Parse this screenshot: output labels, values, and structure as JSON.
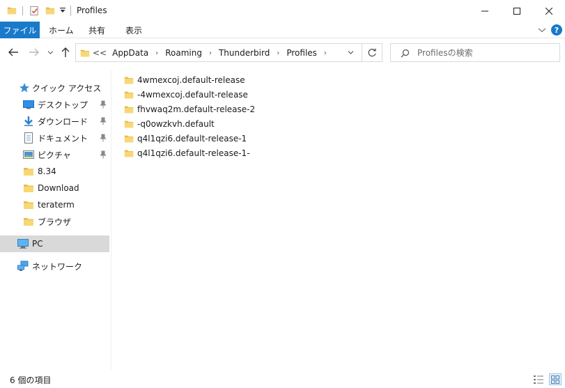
{
  "window": {
    "title": "Profiles"
  },
  "ribbon": {
    "tabs": [
      {
        "label": "ファイル"
      },
      {
        "label": "ホーム"
      },
      {
        "label": "共有"
      },
      {
        "label": "表示"
      }
    ],
    "help_label": "?"
  },
  "address": {
    "overflow": "<<",
    "crumbs": [
      "AppData",
      "Roaming",
      "Thunderbird",
      "Profiles"
    ]
  },
  "search": {
    "placeholder": "Profilesの検索"
  },
  "navigation": {
    "quick_access": "クイック アクセス",
    "items": [
      {
        "label": "デスクトップ",
        "icon": "desktop-icon",
        "pinned": true
      },
      {
        "label": "ダウンロード",
        "icon": "download-icon",
        "pinned": true
      },
      {
        "label": "ドキュメント",
        "icon": "documents-icon",
        "pinned": true
      },
      {
        "label": "ピクチャ",
        "icon": "pictures-icon",
        "pinned": true
      },
      {
        "label": "8.34",
        "icon": "folder-icon",
        "pinned": false
      },
      {
        "label": "Download",
        "icon": "folder-icon",
        "pinned": false
      },
      {
        "label": "teraterm",
        "icon": "folder-icon",
        "pinned": false
      },
      {
        "label": "ブラウザ",
        "icon": "folder-icon",
        "pinned": false
      }
    ],
    "pc": "PC",
    "network": "ネットワーク"
  },
  "files": [
    {
      "name": "4wmexcoj.default-release"
    },
    {
      "name": "-4wmexcoj.default-release"
    },
    {
      "name": "fhvwaq2m.default-release-2"
    },
    {
      "name": "-q0owzkvh.default"
    },
    {
      "name": "q4l1qzi6.default-release-1"
    },
    {
      "name": "q4l1qzi6.default-release-1-"
    }
  ],
  "status": {
    "count": "6 個の項目"
  },
  "colors": {
    "accent": "#1979ca",
    "folder": "#f8d775",
    "folder_dark": "#e8b94a",
    "selection": "#d9d9d9"
  }
}
